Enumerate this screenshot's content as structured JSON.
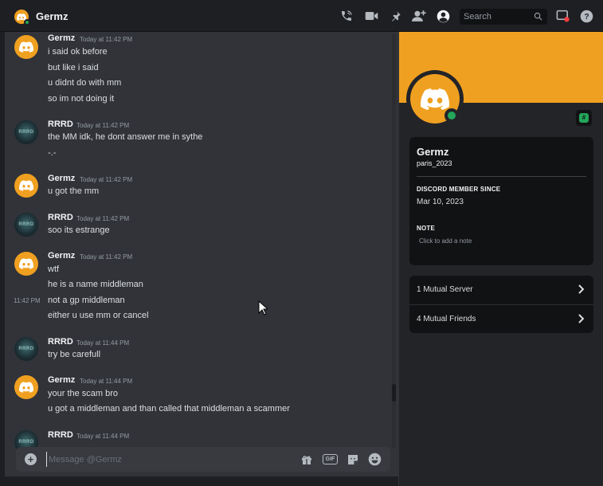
{
  "header": {
    "title": "Germz",
    "search_placeholder": "Search"
  },
  "messages": [
    {
      "author": "Germz",
      "timestamp": "Today at 11:42 PM",
      "avatar": "discord-logo-orange",
      "lines": [
        "i said ok before",
        "but like i said",
        "u didnt do with mm",
        "so im not doing it"
      ]
    },
    {
      "author": "RRRD",
      "timestamp": "Today at 11:42 PM",
      "avatar": "rrrd-avatar",
      "lines": [
        "the MM idk, he dont answer me in sythe",
        "-.-"
      ]
    },
    {
      "author": "Germz",
      "timestamp": "Today at 11:42 PM",
      "avatar": "discord-logo-orange",
      "lines": [
        "u got the mm"
      ]
    },
    {
      "author": "RRRD",
      "timestamp": "Today at 11:42 PM",
      "avatar": "rrrd-avatar",
      "lines": [
        "soo its estrange"
      ]
    },
    {
      "author": "Germz",
      "timestamp": "Today at 11:42 PM",
      "avatar": "discord-logo-orange",
      "lines": [
        "wtf",
        "he is a name middleman",
        "not a gp middleman",
        "either u use mm or cancel"
      ],
      "hover_timestamp": "11:42 PM"
    },
    {
      "author": "RRRD",
      "timestamp": "Today at 11:44 PM",
      "avatar": "rrrd-avatar",
      "lines": [
        "try be carefull"
      ]
    },
    {
      "author": "Germz",
      "timestamp": "Today at 11:44 PM",
      "avatar": "discord-logo-orange",
      "lines": [
        "your the scam bro",
        "u got a middleman and than called that middleman a scammer"
      ]
    },
    {
      "author": "RRRD",
      "timestamp": "Today at 11:44 PM",
      "avatar": "rrrd-avatar",
      "lines": []
    }
  ],
  "rrrd_avatar_text": "RRRD",
  "composer": {
    "placeholder": "Message @Germz",
    "gif_label": "GIF"
  },
  "profile": {
    "display_name": "Germz",
    "username": "paris_2023",
    "member_since_label": "DISCORD MEMBER SINCE",
    "member_since": "Mar 10, 2023",
    "note_label": "NOTE",
    "note_placeholder": "Click to add a note",
    "mutual_servers": "1 Mutual Server",
    "mutual_friends": "4 Mutual Friends",
    "status": "online"
  },
  "colors": {
    "accent_orange": "#f0a020",
    "online_green": "#23a55a"
  }
}
